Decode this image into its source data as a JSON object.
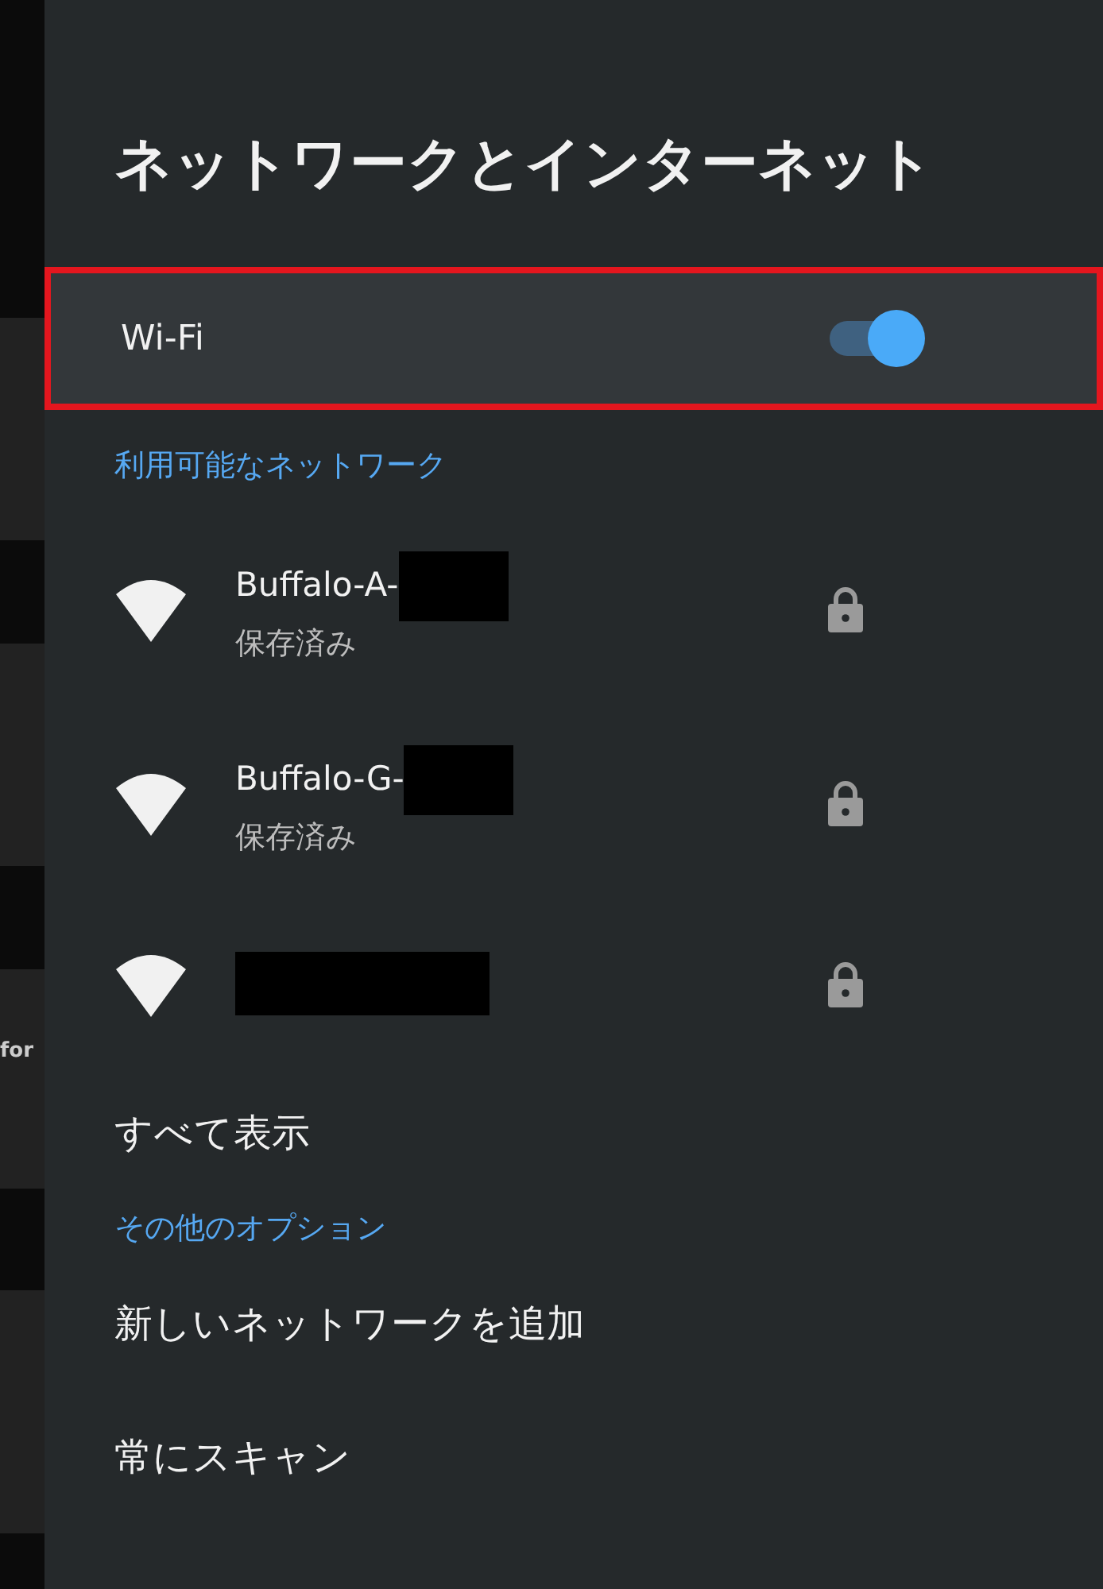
{
  "background_app": {
    "fragment": "for"
  },
  "title": "ネットワークとインターネット",
  "wifi": {
    "label": "Wi-Fi",
    "on": true,
    "highlighted": true
  },
  "sections": [
    {
      "header": "利用可能なネットワーク",
      "networks": [
        {
          "name": "Buffalo-A-",
          "status": "保存済み",
          "redacted": true,
          "secured": true
        },
        {
          "name": "Buffalo-G-",
          "status": "保存済み",
          "redacted": true,
          "secured": true
        },
        {
          "redacted": true,
          "secured": true
        }
      ],
      "items": [
        "すべて表示"
      ]
    },
    {
      "header": "その他のオプション",
      "items": [
        "新しいネットワークを追加",
        "常にスキャン"
      ]
    }
  ]
}
